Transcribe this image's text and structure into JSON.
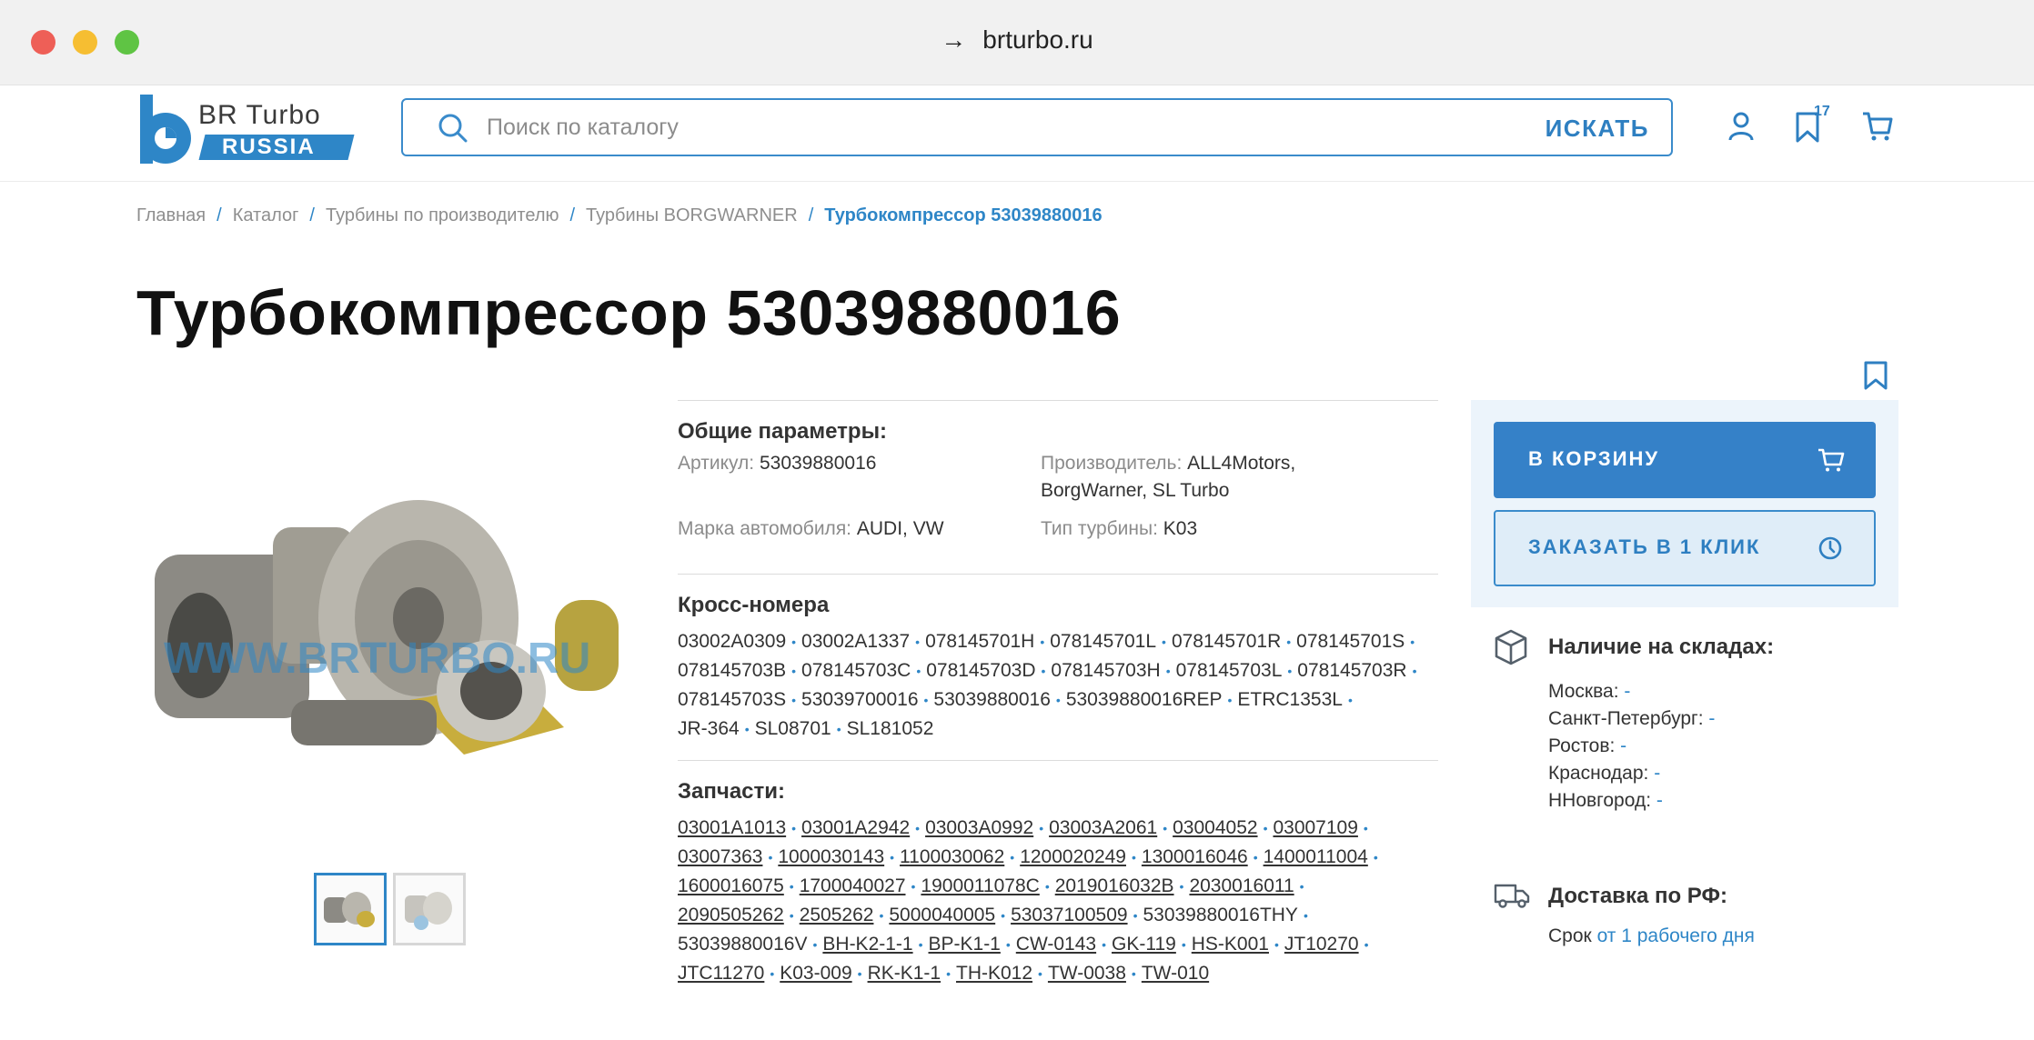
{
  "browser": {
    "url": "brturbo.ru",
    "arrow": "→"
  },
  "logo": {
    "top": "BR Turbo",
    "bottom": "RUSSIA"
  },
  "search": {
    "placeholder": "Поиск по каталогу",
    "button": "ИСКАТЬ"
  },
  "header": {
    "favorites_count": "17"
  },
  "breadcrumb": {
    "items": [
      "Главная",
      "Каталог",
      "Турбины по производителю",
      "Турбины BORGWARNER"
    ],
    "current": "Турбокомпрессор 53039880016"
  },
  "title": "Турбокомпрессор 53039880016",
  "gallery": {
    "watermark": "WWW.BRTURBO.RU"
  },
  "params": {
    "heading": "Общие параметры:",
    "article_label": "Артикул:",
    "article_value": "53039880016",
    "maker_label": "Производитель:",
    "maker_value_1": "ALL4Motors,",
    "maker_value_2": "BorgWarner, SL Turbo",
    "car_label": "Марка автомобиля:",
    "car_value": "AUDI, VW",
    "turbine_label": "Тип турбины:",
    "turbine_value": "K03"
  },
  "cross": {
    "heading": "Кросс-номера",
    "lines": [
      [
        "03002A0309",
        "03002A1337",
        "078145701H",
        "078145701L",
        "078145701R",
        "078145701S"
      ],
      [
        "078145703B",
        "078145703C",
        "078145703D",
        "078145703H",
        "078145703L",
        "078145703R"
      ],
      [
        "078145703S",
        "53039700016",
        "53039880016",
        "53039880016REP",
        "ETRC1353L"
      ],
      [
        "JR-364",
        "SL08701",
        "SL181052"
      ]
    ]
  },
  "parts": {
    "heading": "Запчасти:",
    "lines": [
      [
        "03001A1013",
        "03001A2942",
        "03003A0992",
        "03003A2061",
        "03004052",
        "03007109"
      ],
      [
        "03007363",
        "1000030143",
        "1100030062",
        "1200020249",
        "1300016046",
        "1400011004"
      ],
      [
        "1600016075",
        "1700040027",
        "1900011078C",
        "2019016032B",
        "2030016011"
      ],
      [
        "2090505262",
        "2505262",
        "5000040005",
        "53037100509",
        "53039880016THY"
      ],
      [
        "53039880016V",
        "BH-K2-1-1",
        "BP-K1-1",
        "CW-0143",
        "GK-119",
        "HS-K001",
        "JT10270"
      ],
      [
        "JTC11270",
        "K03-009",
        "RK-K1-1",
        "TH-K012",
        "TW-0038",
        "TW-010"
      ]
    ]
  },
  "actions": {
    "cart": "В КОРЗИНУ",
    "one_click": "ЗАКАЗАТЬ В 1 КЛИК"
  },
  "stock": {
    "heading": "Наличие на складах:",
    "items": [
      {
        "city": "Москва:",
        "value": "-"
      },
      {
        "city": "Санкт-Петербург:",
        "value": "-"
      },
      {
        "city": "Ростов:",
        "value": "-"
      },
      {
        "city": "Краснодар:",
        "value": "-"
      },
      {
        "city": "ННовгород:",
        "value": "-"
      }
    ]
  },
  "delivery": {
    "heading": "Доставка по РФ:",
    "label": "Срок",
    "value": "от 1 рабочего дня"
  },
  "colors": {
    "accent": "#2e86c7",
    "button": "#3581c8"
  }
}
